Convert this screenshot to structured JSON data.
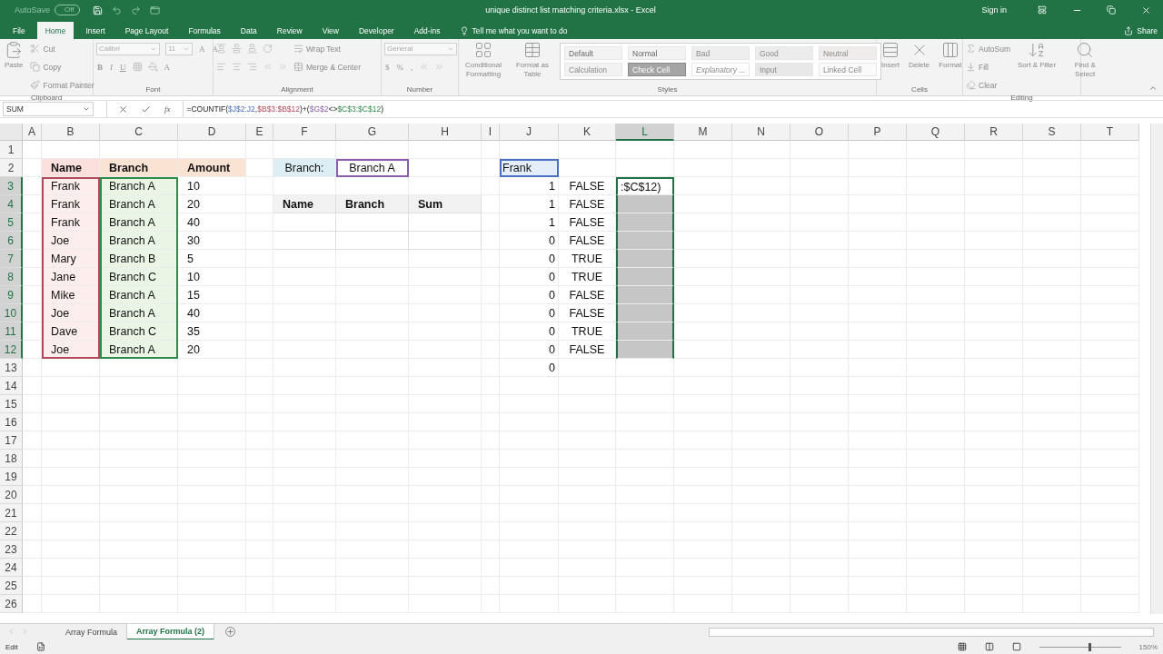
{
  "title_bar": {
    "autosave_label": "AutoSave",
    "autosave_state": "Off",
    "title": "unique distinct list matching criteria.xlsx  -  Excel",
    "sign_in": "Sign in"
  },
  "tabs": [
    {
      "label": "File",
      "selected": false
    },
    {
      "label": "Home",
      "selected": true
    },
    {
      "label": "Insert",
      "selected": false
    },
    {
      "label": "Page Layout",
      "selected": false
    },
    {
      "label": "Formulas",
      "selected": false
    },
    {
      "label": "Data",
      "selected": false
    },
    {
      "label": "Review",
      "selected": false
    },
    {
      "label": "View",
      "selected": false
    },
    {
      "label": "Developer",
      "selected": false
    },
    {
      "label": "Add-ins",
      "selected": false
    }
  ],
  "tell_me": "Tell me what you want to do",
  "share": "Share",
  "ribbon": {
    "groups": [
      {
        "label": "Clipboard",
        "columns": [
          [
            [
              {
                "kind": "paste",
                "label": "Paste"
              }
            ]
          ],
          [
            [
              {
                "kind": "cut",
                "label": "Cut"
              }
            ],
            [
              {
                "kind": "copy",
                "label": "Copy"
              }
            ],
            [
              {
                "kind": "painter",
                "label": "Format Painter"
              }
            ]
          ]
        ]
      },
      {
        "label": "Font",
        "columns": [
          [
            [
              {
                "kind": "font-name",
                "label": "Calibri"
              },
              {
                "kind": "font-size",
                "label": "11"
              },
              {
                "kind": "grow",
                "label": "A"
              },
              {
                "kind": "shrink",
                "label": "A"
              }
            ],
            [
              {
                "kind": "bold",
                "label": "B"
              },
              {
                "kind": "italic",
                "label": "I"
              },
              {
                "kind": "underline",
                "label": "U"
              },
              {
                "kind": "borders"
              },
              {
                "kind": "fill-color"
              },
              {
                "kind": "font-color",
                "label": "A"
              }
            ]
          ]
        ]
      },
      {
        "label": "Alignment",
        "columns": [
          [
            [
              {
                "kind": "top"
              },
              {
                "kind": "middle"
              },
              {
                "kind": "bottom"
              },
              {
                "kind": "orient"
              }
            ],
            [
              {
                "kind": "left"
              },
              {
                "kind": "center"
              },
              {
                "kind": "right"
              },
              {
                "kind": "outdent"
              },
              {
                "kind": "indent"
              }
            ]
          ],
          [
            [
              {
                "kind": "wrap",
                "label": "Wrap Text"
              }
            ],
            [
              {
                "kind": "merge",
                "label": "Merge & Center"
              }
            ]
          ]
        ]
      },
      {
        "label": "Number",
        "columns": [
          [
            [
              {
                "kind": "number-format",
                "label": "General"
              }
            ],
            [
              {
                "kind": "currency",
                "label": "$"
              },
              {
                "kind": "percent",
                "label": "%"
              },
              {
                "kind": "comma",
                "label": ","
              },
              {
                "kind": "inc-dec"
              },
              {
                "kind": "dec-dec"
              }
            ]
          ]
        ]
      },
      {
        "label": "Styles",
        "columns": [
          [
            [
              {
                "kind": "cond",
                "label": "Conditional Formatting"
              }
            ]
          ],
          [
            [
              {
                "kind": "table",
                "label": "Format as Table"
              }
            ]
          ]
        ],
        "gallery": [
          [
            {
              "label": "Default",
              "kind": "plain"
            },
            {
              "label": "Normal",
              "kind": "plain"
            },
            {
              "label": "Bad",
              "kind": "bad"
            },
            {
              "label": "Good",
              "kind": "good"
            },
            {
              "label": "Neutral",
              "kind": "neutral"
            }
          ],
          [
            {
              "label": "Calculation",
              "kind": "calc"
            },
            {
              "label": "Check Cell",
              "kind": "check"
            },
            {
              "label": "Explanatory ...",
              "kind": "note"
            },
            {
              "label": "Input",
              "kind": "input"
            },
            {
              "label": "Linked Cell",
              "kind": "linked"
            }
          ]
        ]
      },
      {
        "label": "Cells",
        "columns": [
          [
            [
              {
                "kind": "insert",
                "label": "Insert"
              }
            ]
          ],
          [
            [
              {
                "kind": "delete",
                "label": "Delete"
              }
            ]
          ],
          [
            [
              {
                "kind": "format",
                "label": "Format"
              }
            ]
          ]
        ]
      },
      {
        "label": "Editing",
        "columns": [
          [
            [
              {
                "kind": "autosum",
                "label": "AutoSum"
              }
            ],
            [
              {
                "kind": "fill",
                "label": "Fill"
              }
            ],
            [
              {
                "kind": "clear",
                "label": "Clear"
              }
            ]
          ],
          [
            [
              {
                "kind": "sort",
                "label": "Sort & Filter"
              }
            ]
          ],
          [
            [
              {
                "kind": "find",
                "label": "Find & Select"
              }
            ]
          ]
        ]
      }
    ]
  },
  "formula_bar": {
    "name_box": "SUM",
    "function_label": "fx",
    "segments": [
      {
        "text": "=COUNTIF(",
        "kind": "plain"
      },
      {
        "text": "$J$2:J2",
        "kind": "ref",
        "color": "#4a6fc4"
      },
      {
        "text": ",",
        "kind": "plain"
      },
      {
        "text": "$B$3:$B$12",
        "kind": "ref",
        "color": "#b5485a"
      },
      {
        "text": ")+(",
        "kind": "plain"
      },
      {
        "text": "$G$2",
        "kind": "ref",
        "color": "#8a5fb0"
      },
      {
        "text": "<>",
        "kind": "plain"
      },
      {
        "text": "$C$3:$C$12",
        "kind": "ref",
        "color": "#2e8b4a"
      },
      {
        "text": ")",
        "kind": "plain"
      }
    ]
  },
  "columns": [
    {
      "label": "A",
      "selected": false
    },
    {
      "label": "B",
      "selected": false
    },
    {
      "label": "C",
      "selected": false
    },
    {
      "label": "D",
      "selected": false
    },
    {
      "label": "E",
      "selected": false
    },
    {
      "label": "F",
      "selected": false
    },
    {
      "label": "G",
      "selected": false
    },
    {
      "label": "H",
      "selected": false
    },
    {
      "label": "I",
      "selected": false
    },
    {
      "label": "J",
      "selected": false
    },
    {
      "label": "K",
      "selected": false
    },
    {
      "label": "L",
      "selected": true
    },
    {
      "label": "M",
      "selected": false
    },
    {
      "label": "N",
      "selected": false
    },
    {
      "label": "O",
      "selected": false
    },
    {
      "label": "P",
      "selected": false
    },
    {
      "label": "Q",
      "selected": false
    },
    {
      "label": "R",
      "selected": false
    },
    {
      "label": "S",
      "selected": false
    },
    {
      "label": "T",
      "selected": false
    }
  ],
  "rows": [
    {
      "label": "1",
      "selected": false,
      "cells": {}
    },
    {
      "label": "2",
      "selected": false,
      "cells": {
        "B": {
          "text": "Name",
          "kind": "name-header"
        },
        "C": {
          "text": "Branch",
          "kind": "branch-header"
        },
        "D": {
          "text": "Amount",
          "kind": "amount-header"
        },
        "F": {
          "text": "Branch:",
          "kind": "criteria-label"
        },
        "G": {
          "text": "Branch A",
          "kind": "criteria"
        },
        "J": {
          "text": "Frank",
          "kind": "lookup"
        }
      }
    },
    {
      "label": "3",
      "selected": true,
      "cells": {
        "B": {
          "text": "Frank",
          "kind": "name"
        },
        "C": {
          "text": "Branch A",
          "kind": "branch"
        },
        "D": {
          "text": "10",
          "kind": "text"
        },
        "J": {
          "text": "1",
          "kind": "number"
        },
        "K": {
          "text": "FALSE",
          "kind": "bool"
        },
        "L": {
          "text": ":$C$12)",
          "kind": "edit"
        }
      }
    },
    {
      "label": "4",
      "selected": true,
      "cells": {
        "B": {
          "text": "Frank",
          "kind": "name"
        },
        "C": {
          "text": "Branch A",
          "kind": "branch"
        },
        "D": {
          "text": "20",
          "kind": "text"
        },
        "F": {
          "text": "Name",
          "kind": "table-header"
        },
        "G": {
          "text": "Branch",
          "kind": "table-header"
        },
        "H": {
          "text": "Sum",
          "kind": "table-header"
        },
        "J": {
          "text": "1",
          "kind": "number"
        },
        "K": {
          "text": "FALSE",
          "kind": "bool"
        },
        "L": {
          "kind": "selected"
        }
      }
    },
    {
      "label": "5",
      "selected": true,
      "cells": {
        "B": {
          "text": "Frank",
          "kind": "name"
        },
        "C": {
          "text": "Branch A",
          "kind": "branch"
        },
        "D": {
          "text": "40",
          "kind": "text"
        },
        "F": {
          "kind": "table-cell"
        },
        "G": {
          "kind": "table-cell"
        },
        "H": {
          "kind": "table-cell"
        },
        "J": {
          "text": "1",
          "kind": "number"
        },
        "K": {
          "text": "FALSE",
          "kind": "bool"
        },
        "L": {
          "kind": "selected"
        }
      }
    },
    {
      "label": "6",
      "selected": true,
      "cells": {
        "B": {
          "text": "Joe",
          "kind": "name"
        },
        "C": {
          "text": "Branch A",
          "kind": "branch"
        },
        "D": {
          "text": "30",
          "kind": "text"
        },
        "F": {
          "kind": "table-cell"
        },
        "G": {
          "kind": "table-cell"
        },
        "H": {
          "kind": "table-cell"
        },
        "J": {
          "text": "0",
          "kind": "number"
        },
        "K": {
          "text": "FALSE",
          "kind": "bool"
        },
        "L": {
          "kind": "selected"
        }
      }
    },
    {
      "label": "7",
      "selected": true,
      "cells": {
        "B": {
          "text": "Mary",
          "kind": "name"
        },
        "C": {
          "text": "Branch B",
          "kind": "branch"
        },
        "D": {
          "text": "5",
          "kind": "text"
        },
        "J": {
          "text": "0",
          "kind": "number"
        },
        "K": {
          "text": "TRUE",
          "kind": "bool"
        },
        "L": {
          "kind": "selected"
        }
      }
    },
    {
      "label": "8",
      "selected": true,
      "cells": {
        "B": {
          "text": "Jane",
          "kind": "name"
        },
        "C": {
          "text": "Branch C",
          "kind": "branch"
        },
        "D": {
          "text": "10",
          "kind": "text"
        },
        "J": {
          "text": "0",
          "kind": "number"
        },
        "K": {
          "text": "TRUE",
          "kind": "bool"
        },
        "L": {
          "kind": "selected"
        }
      }
    },
    {
      "label": "9",
      "selected": true,
      "cells": {
        "B": {
          "text": "Mike",
          "kind": "name"
        },
        "C": {
          "text": "Branch A",
          "kind": "branch"
        },
        "D": {
          "text": "15",
          "kind": "text"
        },
        "J": {
          "text": "0",
          "kind": "number"
        },
        "K": {
          "text": "FALSE",
          "kind": "bool"
        },
        "L": {
          "kind": "selected"
        }
      }
    },
    {
      "label": "10",
      "selected": true,
      "cells": {
        "B": {
          "text": "Joe",
          "kind": "name"
        },
        "C": {
          "text": "Branch A",
          "kind": "branch"
        },
        "D": {
          "text": "40",
          "kind": "text"
        },
        "J": {
          "text": "0",
          "kind": "number"
        },
        "K": {
          "text": "FALSE",
          "kind": "bool"
        },
        "L": {
          "kind": "selected"
        }
      }
    },
    {
      "label": "11",
      "selected": true,
      "cells": {
        "B": {
          "text": "Dave",
          "kind": "name"
        },
        "C": {
          "text": "Branch C",
          "kind": "branch"
        },
        "D": {
          "text": "35",
          "kind": "text"
        },
        "J": {
          "text": "0",
          "kind": "number"
        },
        "K": {
          "text": "TRUE",
          "kind": "bool"
        },
        "L": {
          "kind": "selected"
        }
      }
    },
    {
      "label": "12",
      "selected": true,
      "cells": {
        "B": {
          "text": "Joe",
          "kind": "name"
        },
        "C": {
          "text": "Branch A",
          "kind": "branch"
        },
        "D": {
          "text": "20",
          "kind": "text"
        },
        "J": {
          "text": "0",
          "kind": "number"
        },
        "K": {
          "text": "FALSE",
          "kind": "bool"
        },
        "L": {
          "kind": "selected"
        }
      }
    },
    {
      "label": "13",
      "selected": false,
      "cells": {
        "J": {
          "text": "0",
          "kind": "number"
        }
      }
    },
    {
      "label": "14",
      "selected": false,
      "cells": {}
    },
    {
      "label": "15",
      "selected": false,
      "cells": {}
    },
    {
      "label": "16",
      "selected": false,
      "cells": {}
    },
    {
      "label": "17",
      "selected": false,
      "cells": {}
    },
    {
      "label": "18",
      "selected": false,
      "cells": {}
    },
    {
      "label": "19",
      "selected": false,
      "cells": {}
    },
    {
      "label": "20",
      "selected": false,
      "cells": {}
    },
    {
      "label": "21",
      "selected": false,
      "cells": {}
    },
    {
      "label": "22",
      "selected": false,
      "cells": {}
    },
    {
      "label": "23",
      "selected": false,
      "cells": {}
    },
    {
      "label": "24",
      "selected": false,
      "cells": {}
    },
    {
      "label": "25",
      "selected": false,
      "cells": {}
    },
    {
      "label": "26",
      "selected": false,
      "cells": {}
    }
  ],
  "sheet_tabs": [
    {
      "label": "Array Formula",
      "selected": false
    },
    {
      "label": "Array Formula (2)",
      "selected": true
    }
  ],
  "status_bar": {
    "mode": "Edit",
    "zoom_slider": {
      "level": 0.6
    },
    "zoom": "150%"
  }
}
